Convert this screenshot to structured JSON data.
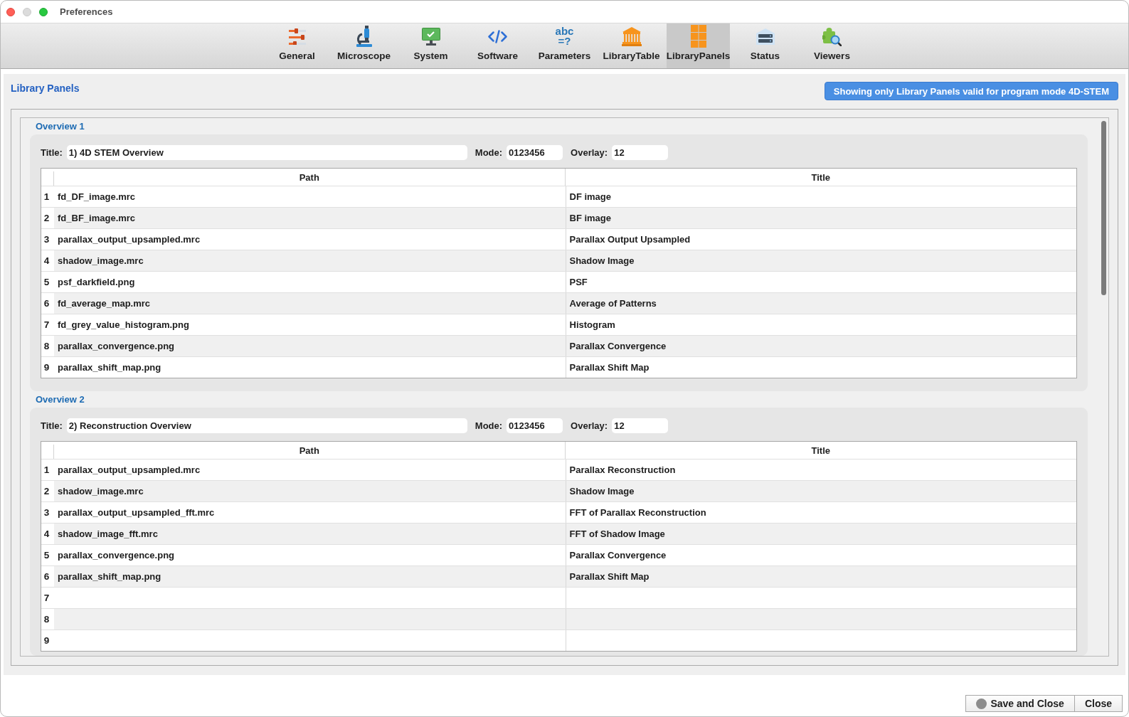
{
  "window": {
    "title": "Preferences",
    "controls": [
      {
        "disabled": false
      },
      {
        "disabled": true
      },
      {
        "disabled": false
      }
    ]
  },
  "toolbar": [
    {
      "label": "General",
      "selected": false
    },
    {
      "label": "Microscope",
      "selected": false
    },
    {
      "label": "System",
      "selected": false
    },
    {
      "label": "Software",
      "selected": false
    },
    {
      "label": "Parameters",
      "selected": false,
      "icon_lines": [
        "abc",
        "=?"
      ]
    },
    {
      "label": "LibraryTable",
      "selected": false
    },
    {
      "label": "LibraryPanels",
      "selected": true
    },
    {
      "label": "Status",
      "selected": false
    },
    {
      "label": "Viewers",
      "selected": false
    }
  ],
  "page": {
    "title": "Library Panels",
    "mode_notice": "Showing only Library Panels valid for program mode 4D-STEM"
  },
  "panels": [
    {
      "heading": "Overview 1",
      "fields": [
        {
          "label": "Title:",
          "value": "1) 4D STEM Overview"
        },
        {
          "label": "Mode:",
          "value": "0123456"
        },
        {
          "label": "Overlay:",
          "value": "12"
        }
      ],
      "columns": [
        "Path",
        "Title"
      ],
      "rows": [
        {
          "number": "1",
          "path": "fd_DF_image.mrc",
          "title": "DF image"
        },
        {
          "number": "2",
          "path": "fd_BF_image.mrc",
          "title": "BF image"
        },
        {
          "number": "3",
          "path": "parallax_output_upsampled.mrc",
          "title": "Parallax Output Upsampled"
        },
        {
          "number": "4",
          "path": "shadow_image.mrc",
          "title": "Shadow Image"
        },
        {
          "number": "5",
          "path": "psf_darkfield.png",
          "title": "PSF"
        },
        {
          "number": "6",
          "path": "fd_average_map.mrc",
          "title": "Average of Patterns"
        },
        {
          "number": "7",
          "path": "fd_grey_value_histogram.png",
          "title": "Histogram"
        },
        {
          "number": "8",
          "path": "parallax_convergence.png",
          "title": "Parallax Convergence"
        },
        {
          "number": "9",
          "path": "parallax_shift_map.png",
          "title": "Parallax Shift Map"
        }
      ]
    },
    {
      "heading": "Overview 2",
      "fields": [
        {
          "label": "Title:",
          "value": "2) Reconstruction Overview"
        },
        {
          "label": "Mode:",
          "value": "0123456"
        },
        {
          "label": "Overlay:",
          "value": "12"
        }
      ],
      "columns": [
        "Path",
        "Title"
      ],
      "rows": [
        {
          "number": "1",
          "path": "parallax_output_upsampled.mrc",
          "title": "Parallax Reconstruction"
        },
        {
          "number": "2",
          "path": "shadow_image.mrc",
          "title": "Shadow Image"
        },
        {
          "number": "3",
          "path": "parallax_output_upsampled_fft.mrc",
          "title": "FFT of Parallax Reconstruction"
        },
        {
          "number": "4",
          "path": "shadow_image_fft.mrc",
          "title": "FFT of Shadow Image"
        },
        {
          "number": "5",
          "path": "parallax_convergence.png",
          "title": "Parallax Convergence"
        },
        {
          "number": "6",
          "path": "parallax_shift_map.png",
          "title": "Parallax Shift Map"
        },
        {
          "number": "7"
        },
        {
          "number": "8"
        },
        {
          "number": "9"
        }
      ]
    }
  ],
  "buttons": [
    {
      "label": "Save and Close",
      "kind": "icon"
    },
    {
      "label": "Close",
      "kind": "text"
    }
  ]
}
